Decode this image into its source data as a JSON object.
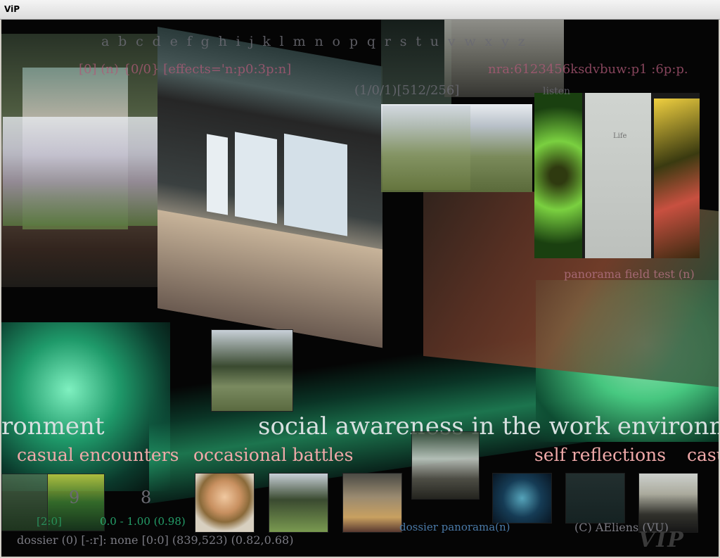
{
  "window": {
    "title": "ViP"
  },
  "overlay": {
    "alphabet": "a b c d e f g h i j k l m n o p q r s t u v w x y z",
    "status_left": "[0] (n) {0/0} [effects='n:p0:3p:n]",
    "status_right": "nra:6123456ksdvbuw:p1 :6p:p.",
    "coords": "(1/0/1)[512/256]",
    "listen": "listen",
    "panorama_caption": "panorama field test (n)",
    "poster_title": "Life"
  },
  "captions": {
    "line1_left": "ronment",
    "line1_right": "social awareness in the work environm",
    "line2": [
      "casual encounters",
      "occasional battles",
      "self reflections",
      "casu"
    ]
  },
  "dock": {
    "number_9": "9",
    "number_8": "8",
    "range": "0.0 - 1.00 (0.98)",
    "range_prefix": "[2:0]",
    "dossier_label": "dossier panorama(n)",
    "copyright": "(C) AEliens (VU)",
    "status": "dossier (0) [-:r]: none [0:0] (839,523) (0.82,0.68)",
    "logo": "VIP"
  },
  "colors": {
    "caption_pink": "#f0a9a9",
    "caption_white": "#d8e0e0",
    "overlay_pink": "#b05a78",
    "overlay_gray": "#6a6a72",
    "glow_green": "#2fd08a"
  }
}
